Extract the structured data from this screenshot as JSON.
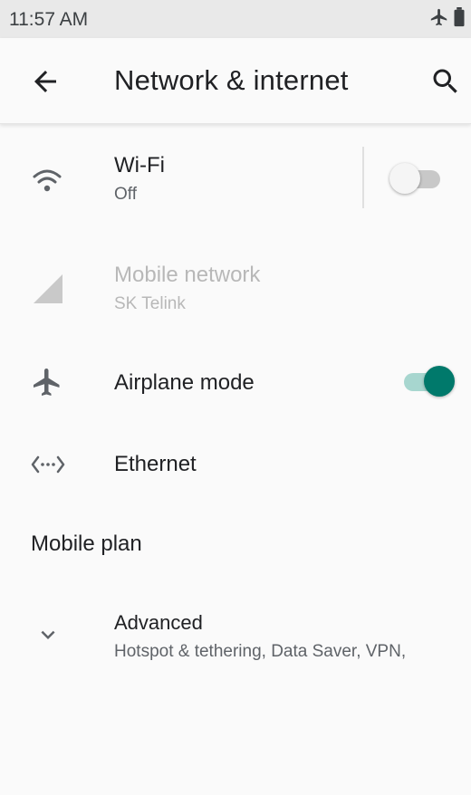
{
  "status_bar": {
    "time": "11:57 AM",
    "icons": [
      "airplane-icon",
      "battery-icon"
    ]
  },
  "app_bar": {
    "title": "Network & internet",
    "back_icon": "arrow-back-icon",
    "search_icon": "search-icon"
  },
  "settings": {
    "wifi": {
      "title": "Wi-Fi",
      "summary": "Off",
      "icon": "wifi-icon",
      "toggle_on": false
    },
    "mobile_network": {
      "title": "Mobile network",
      "summary": "SK Telink",
      "icon": "signal-icon",
      "enabled": false
    },
    "airplane_mode": {
      "title": "Airplane mode",
      "icon": "airplane-icon",
      "toggle_on": true
    },
    "ethernet": {
      "title": "Ethernet",
      "icon": "ethernet-icon"
    },
    "mobile_plan": {
      "title": "Mobile plan"
    },
    "advanced": {
      "title": "Advanced",
      "summary": "Hotspot & tethering, Data Saver, VPN,",
      "icon": "chevron-down-icon"
    }
  },
  "colors": {
    "accent": "#00796b",
    "accent_track": "#a7d6cf",
    "status_bar_bg": "#e9e9e9",
    "background": "#fafafa",
    "disabled_text": "#b8b8b8"
  }
}
